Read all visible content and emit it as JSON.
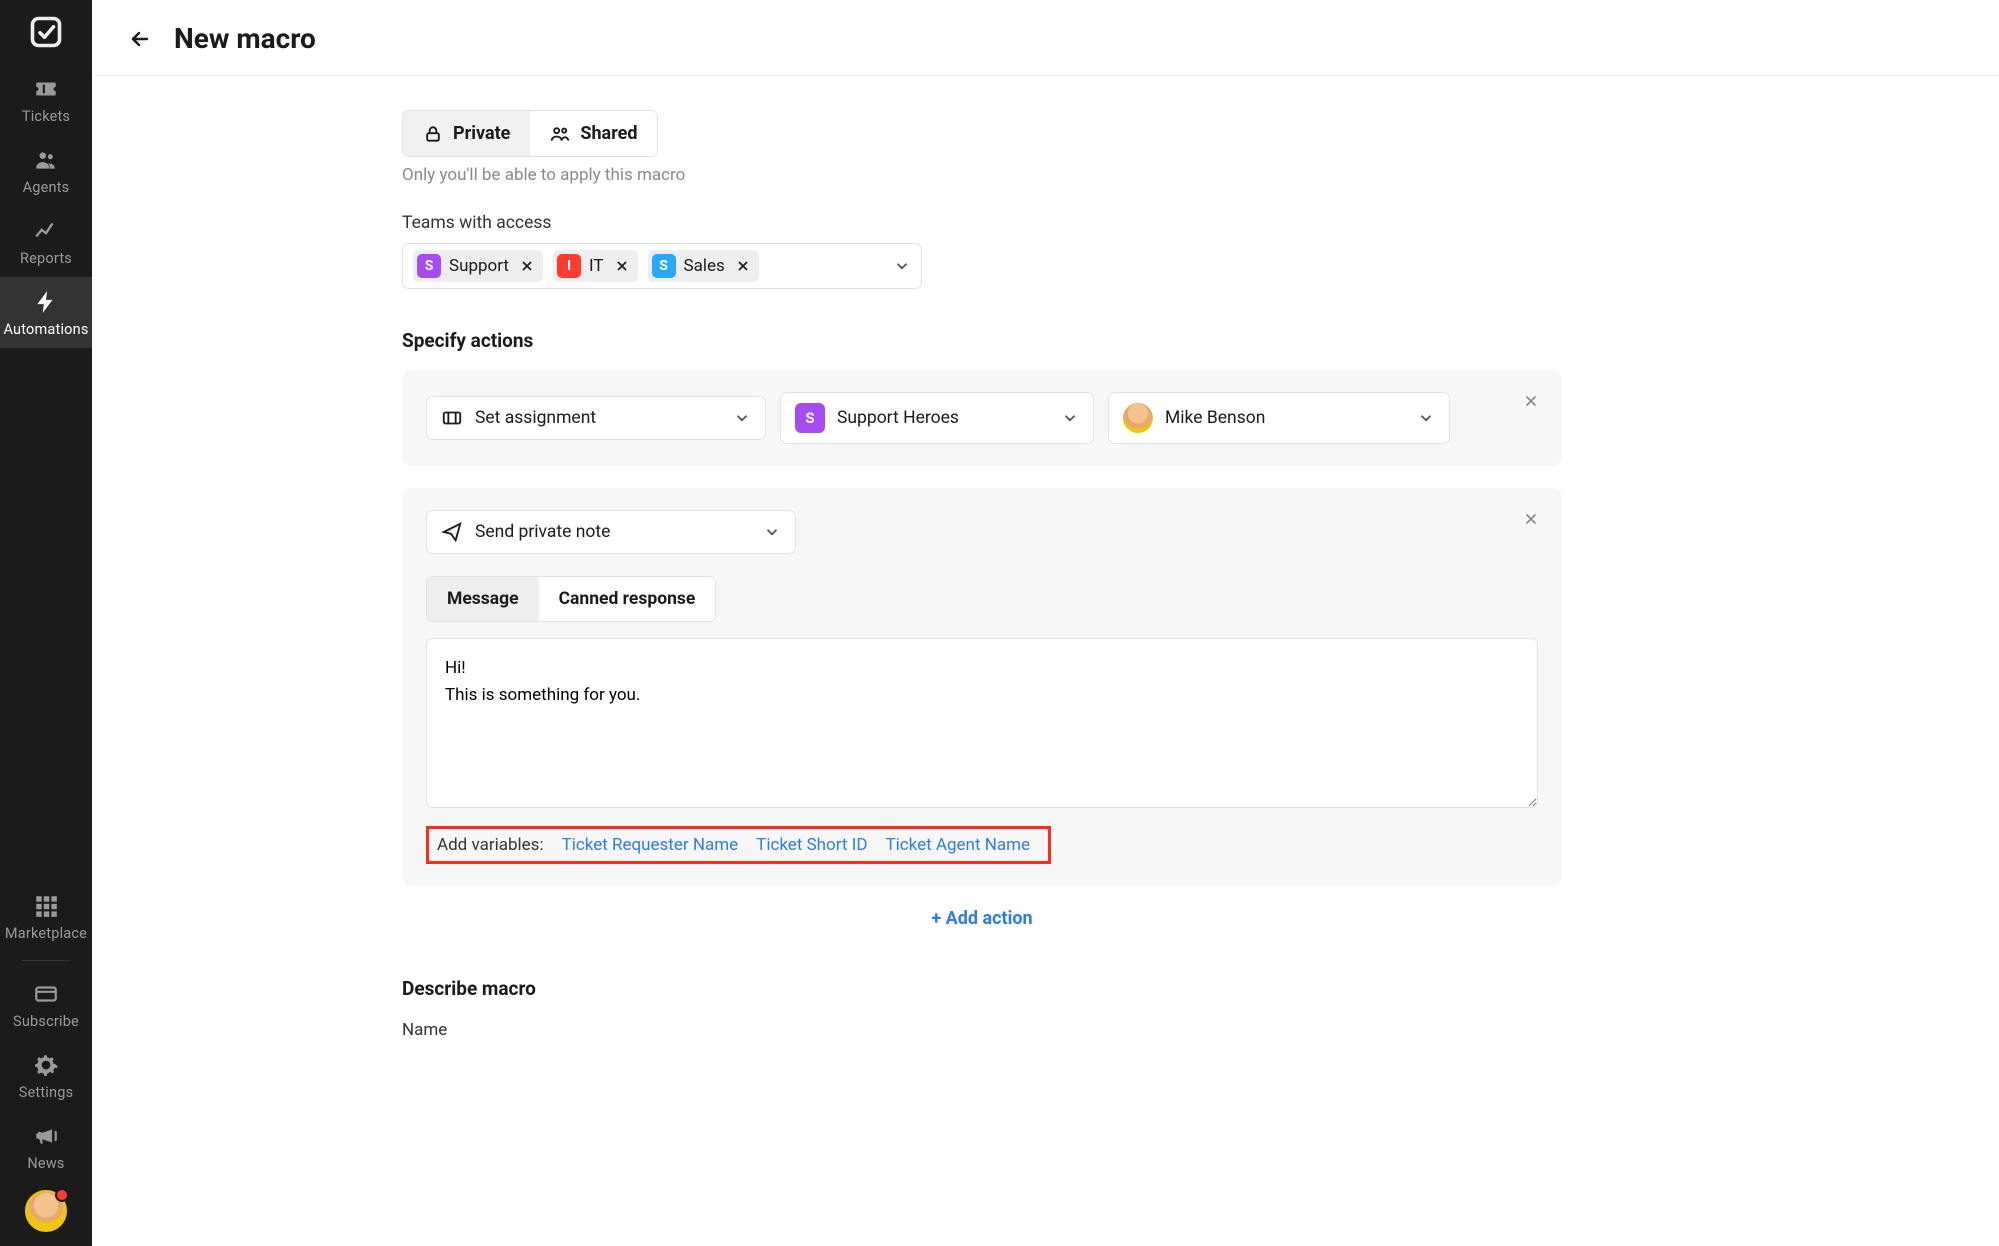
{
  "sidebar": {
    "items": [
      {
        "label": "Tickets"
      },
      {
        "label": "Agents"
      },
      {
        "label": "Reports"
      },
      {
        "label": "Automations"
      }
    ],
    "bottom": [
      {
        "label": "Marketplace"
      },
      {
        "label": "Subscribe"
      },
      {
        "label": "Settings"
      },
      {
        "label": "News"
      }
    ]
  },
  "header": {
    "title": "New macro"
  },
  "visibility": {
    "options": [
      {
        "label": "Private"
      },
      {
        "label": "Shared"
      }
    ],
    "hint": "Only you'll be able to apply this macro"
  },
  "teams": {
    "label": "Teams with access",
    "items": [
      {
        "label": "Support",
        "initial": "S",
        "color": "#a44cf2"
      },
      {
        "label": "IT",
        "initial": "I",
        "color": "#ff3b30"
      },
      {
        "label": "Sales",
        "initial": "S",
        "color": "#2aa8ff"
      }
    ]
  },
  "actions": {
    "title": "Specify actions",
    "row1": {
      "action_select": "Set assignment",
      "team": {
        "label": "Support Heroes",
        "initial": "S",
        "color": "#a44cf2"
      },
      "agent": {
        "label": "Mike Benson"
      }
    },
    "row2": {
      "action_select": "Send private note",
      "tabs": [
        {
          "label": "Message"
        },
        {
          "label": "Canned response"
        }
      ],
      "message": "Hi!\nThis is something for you.",
      "variables": {
        "label": "Add variables:",
        "items": [
          "Ticket Requester Name",
          "Ticket Short ID",
          "Ticket Agent Name"
        ]
      }
    },
    "add_action": "+ Add action"
  },
  "describe": {
    "title": "Describe macro",
    "name_label": "Name"
  }
}
